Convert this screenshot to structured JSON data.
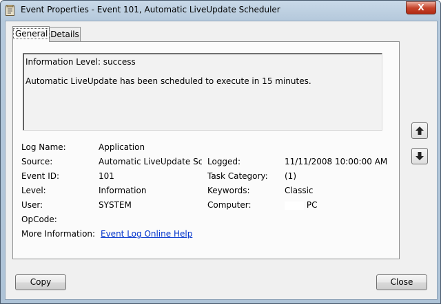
{
  "window": {
    "title": "Event Properties - Event 101, Automatic LiveUpdate Scheduler",
    "close_glyph": "X"
  },
  "tabs": [
    {
      "label": "General",
      "active": true
    },
    {
      "label": "Details",
      "active": false
    }
  ],
  "message": {
    "line1": "Information Level: success",
    "line2": "Automatic LiveUpdate has been scheduled to execute in 15 minutes."
  },
  "fields": {
    "log_name": {
      "label": "Log Name:",
      "value": "Application"
    },
    "source": {
      "label": "Source:",
      "value": "Automatic LiveUpdate Schec"
    },
    "logged": {
      "label": "Logged:",
      "value": "11/11/2008 10:00:00 AM"
    },
    "event_id": {
      "label": "Event ID:",
      "value": "101"
    },
    "task_category": {
      "label": "Task Category:",
      "value": "(1)"
    },
    "level": {
      "label": "Level:",
      "value": "Information"
    },
    "keywords": {
      "label": "Keywords:",
      "value": "Classic"
    },
    "user": {
      "label": "User:",
      "value": "SYSTEM"
    },
    "computer": {
      "label": "Computer:",
      "value": "PC"
    },
    "opcode": {
      "label": "OpCode:",
      "value": ""
    },
    "more_info": {
      "label": "More Information:",
      "link": "Event Log Online Help"
    }
  },
  "buttons": {
    "copy": "Copy",
    "close": "Close"
  },
  "icons": {
    "up": "up-arrow-icon",
    "down": "down-arrow-icon",
    "app": "event-viewer-icon"
  }
}
